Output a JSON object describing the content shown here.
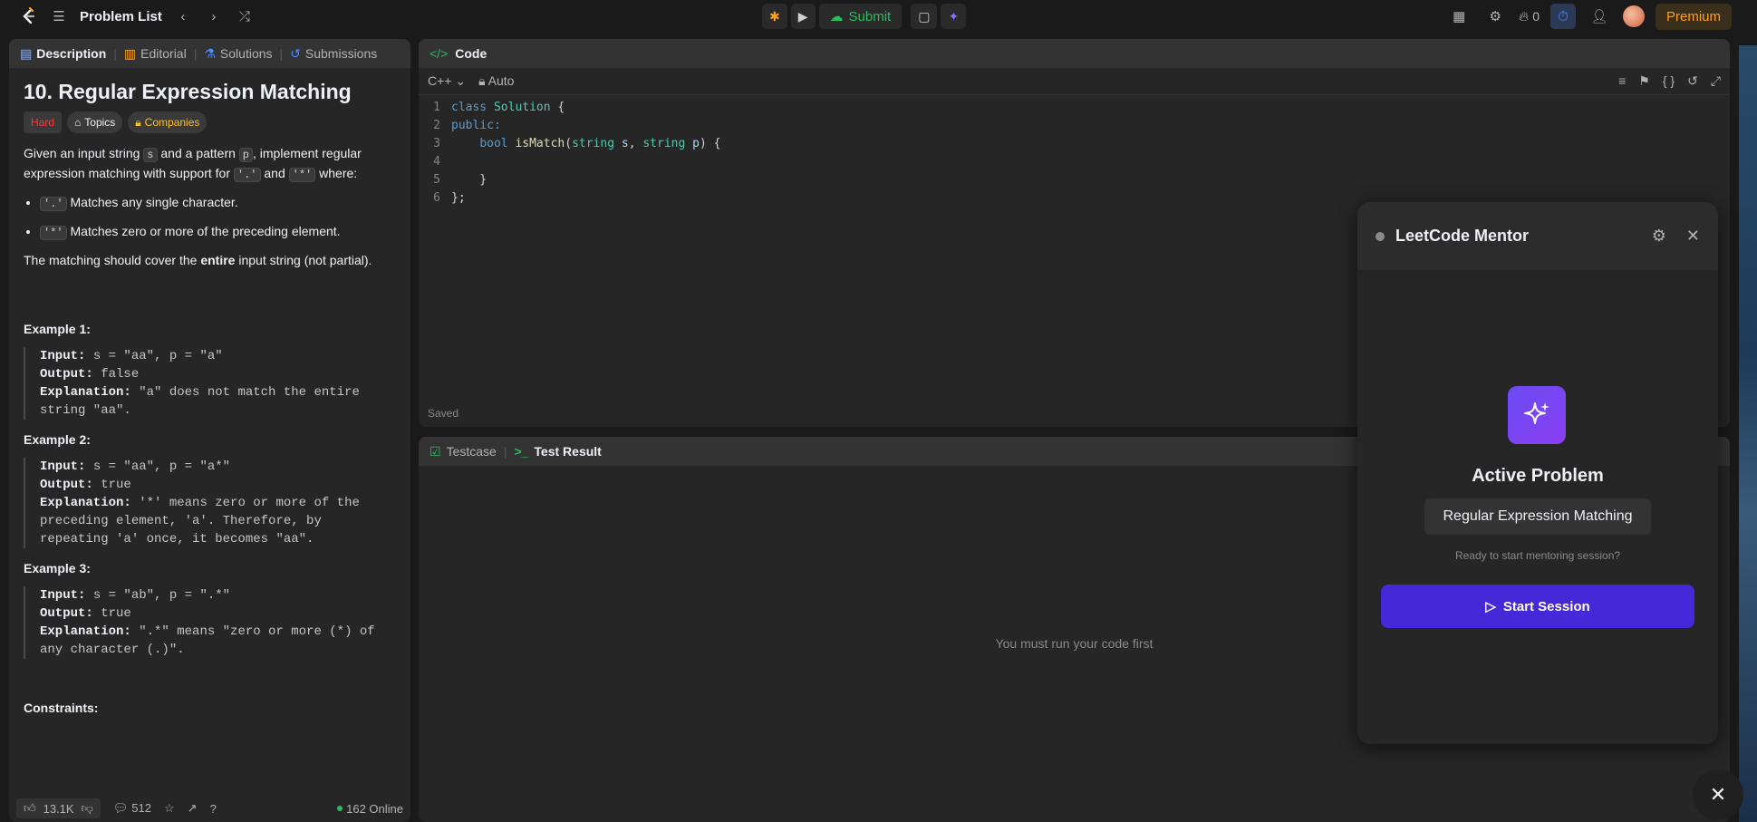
{
  "topbar": {
    "title": "Problem List",
    "submit_label": "Submit",
    "streak_count": "0",
    "premium_label": "Premium"
  },
  "description": {
    "tabs": [
      "Description",
      "Editorial",
      "Solutions",
      "Submissions"
    ],
    "title": "10. Regular Expression Matching",
    "tags": [
      "Hard",
      "Topics",
      "Companies"
    ],
    "intro_1": "Given an input string ",
    "intro_s": "s",
    "intro_2": " and a pattern ",
    "intro_p": "p",
    "intro_3": ", implement regular expression matching with support for ",
    "intro_dot": "'.'",
    "intro_and": " and ",
    "intro_star": "'*'",
    "intro_4": " where:",
    "bullet_1_code": "'.'",
    "bullet_1_text": " Matches any single character.",
    "bullet_2_code": "'*'",
    "bullet_2_text": " Matches zero or more of the preceding element.",
    "cover_1": "The matching should cover the ",
    "cover_bold": "entire",
    "cover_2": " input string (not partial).",
    "examples": [
      {
        "title": "Example 1:",
        "input": " s = \"aa\", p = \"a\"",
        "output": " false",
        "explanation": " \"a\" does not match the entire string \"aa\"."
      },
      {
        "title": "Example 2:",
        "input": " s = \"aa\", p = \"a*\"",
        "output": " true",
        "explanation": " '*' means zero or more of the preceding element, 'a'. Therefore, by repeating 'a' once, it becomes \"aa\"."
      },
      {
        "title": "Example 3:",
        "input": " s = \"ab\", p = \".*\"",
        "output": " true",
        "explanation": " \".*\" means \"zero or more (*) of any character (.)\"."
      }
    ],
    "input_label": "Input:",
    "output_label": "Output:",
    "explanation_label": "Explanation:",
    "constraints_title": "Constraints:",
    "footer": {
      "likes": "13.1K",
      "comments": "512",
      "online": "162 Online"
    }
  },
  "code": {
    "tab": "Code",
    "language": "C++",
    "mode": "Auto",
    "saved": "Saved",
    "line_numbers": [
      "1",
      "2",
      "3",
      "4",
      "5",
      "6"
    ]
  },
  "result": {
    "tabs": [
      "Testcase",
      "Test Result"
    ],
    "empty": "You must run your code first"
  },
  "mentor": {
    "title": "LeetCode Mentor",
    "active_label": "Active Problem",
    "problem": "Regular Expression Matching",
    "ready": "Ready to start mentoring session?",
    "start_label": "Start Session"
  }
}
